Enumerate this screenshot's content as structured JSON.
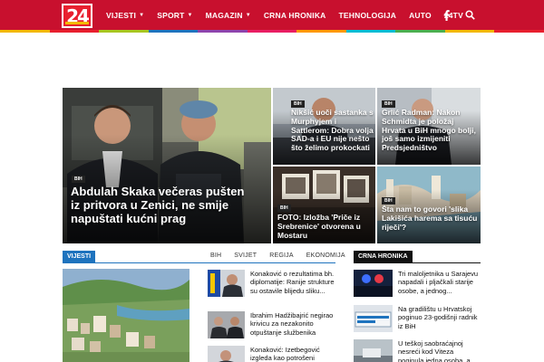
{
  "header": {
    "logo": "24",
    "nav": [
      {
        "label": "VIJESTI",
        "dropdown": true
      },
      {
        "label": "SPORT",
        "dropdown": true
      },
      {
        "label": "MAGAZIN",
        "dropdown": true
      },
      {
        "label": "CRNA HRONIKA",
        "dropdown": false
      },
      {
        "label": "TEHNOLOGIJA",
        "dropdown": false
      },
      {
        "label": "AUTO",
        "dropdown": false
      },
      {
        "label": "24TV",
        "dropdown": false
      }
    ],
    "icons": [
      "facebook-icon",
      "search-icon"
    ],
    "stripe_colors": [
      "#f3b800",
      "#e8202f",
      "#a8c620",
      "#1e73be",
      "#8e44ad",
      "#e91e63",
      "#ff9800",
      "#00bcd4",
      "#4caf50",
      "#f3b800",
      "#e8202f"
    ]
  },
  "hero": {
    "main": {
      "badge": "BIH",
      "title": "Abdulah Skaka večeras pušten iz pritvora u Zenici, ne smije napuštati kućni prag"
    },
    "tiles": [
      {
        "badge": "BIH",
        "title": "Nikšić uoči sastanka s Murphyjem i Sattlerom: Dobra volja SAD-a i EU nije nešto što želimo prokockati"
      },
      {
        "badge": "BIH",
        "title": "Grlić Radman: Nakon Schmidta je položaj Hrvata u BiH mnogo bolji, još samo izmijeniti Predsjedništvo"
      },
      {
        "badge": "BIH",
        "title": "FOTO: Izložba 'Priče iz Srebrenice' otvorena u Mostaru"
      },
      {
        "badge": "BIH",
        "title": "Šta nam to govori 'slika Lakišića harema sa tisuću riječi'?"
      }
    ]
  },
  "vijesti": {
    "tag": "VIJESTI",
    "filters": [
      "BIH",
      "SVIJET",
      "REGIJA",
      "EKONOMIJA"
    ],
    "items": [
      "Konaković o rezultatima bh. diplomatije: Ranije strukture su ostavile blijedu sliku...",
      "Ibrahim Hadžibajrić negirao krivicu za nezakonito otpuštanje službenika",
      "Konaković: Izetbegović izgleda kao potrošeni"
    ]
  },
  "crna_hronika": {
    "tag": "CRNA HRONIKA",
    "items": [
      "Tri maloljetnika u Sarajevu napadali i pljačkali starije osobe, a jednog...",
      "Na gradilištu u Hrvatskoj poginuo 23-godišnji radnik iz BiH",
      "U teškoj saobraćajnoj nesreći kod Viteza poginula jedna osoba, a..."
    ]
  }
}
